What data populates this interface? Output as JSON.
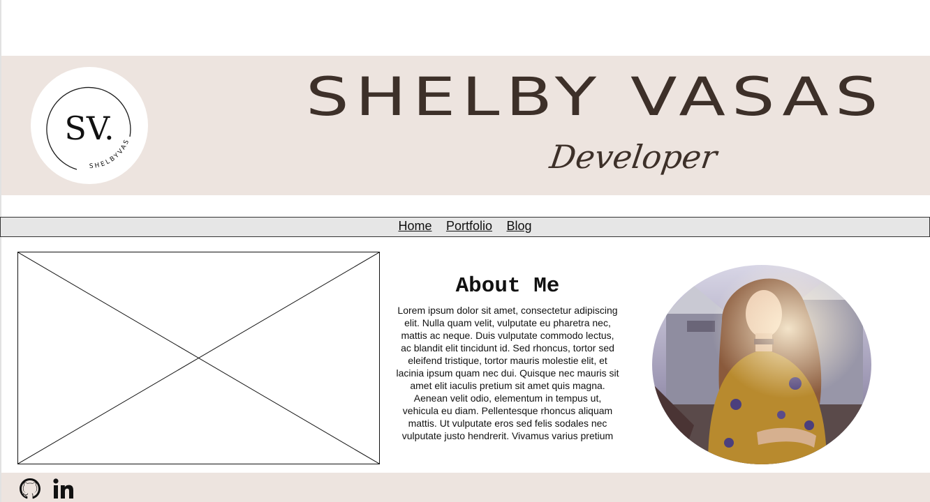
{
  "header": {
    "name": "SHELBY VASAS",
    "role": "Developer",
    "logo": {
      "monogram": "SV.",
      "ring_text": "SHELBYVASAS"
    }
  },
  "nav": {
    "items": [
      {
        "label": "Home"
      },
      {
        "label": "Portfolio"
      },
      {
        "label": "Blog"
      }
    ]
  },
  "about": {
    "heading": "About Me",
    "body": "Lorem ipsum dolor sit amet, consectetur adipiscing elit. Nulla quam velit, vulputate eu pharetra nec, mattis ac neque. Duis vulputate commodo lectus, ac blandit elit tincidunt id. Sed rhoncus, tortor sed eleifend tristique, tortor mauris molestie elit, et lacinia ipsum quam nec dui. Quisque nec mauris sit amet elit iaculis pretium sit amet quis magna. Aenean velit odio, elementum in tempus ut, vehicula eu diam. Pellentesque rhoncus aliquam mattis. Ut vulputate eros sed felis sodales nec vulputate justo hendrerit. Vivamus varius pretium"
  },
  "footer": {
    "social": [
      {
        "icon": "github-icon"
      },
      {
        "icon": "linkedin-icon"
      }
    ]
  },
  "colors": {
    "banner_bg": "#ede4df",
    "title_text": "#3d3029",
    "nav_bg": "#e6e6e6",
    "footer_bg": "#ede4df"
  }
}
